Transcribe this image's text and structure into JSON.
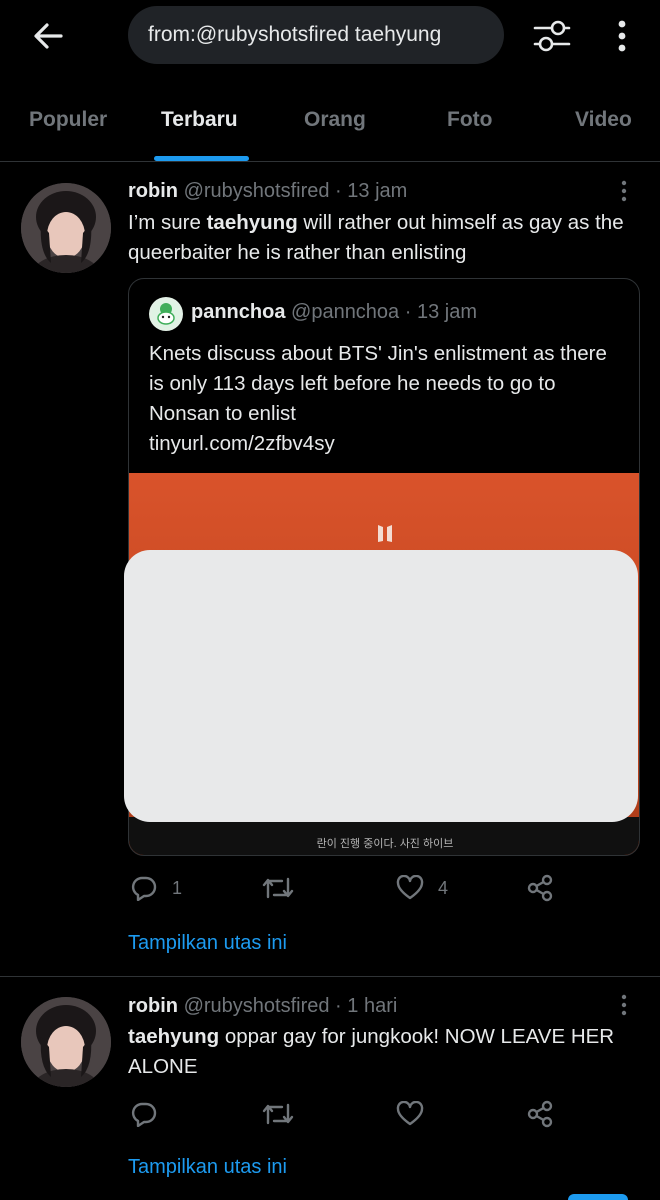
{
  "search": {
    "query": "from:@rubyshotsfired taehyung"
  },
  "tabs": [
    {
      "label": "Populer"
    },
    {
      "label": "Terbaru"
    },
    {
      "label": "Orang"
    },
    {
      "label": "Foto"
    },
    {
      "label": "Video"
    }
  ],
  "active_tab": "Terbaru",
  "tweets": [
    {
      "name": "robin",
      "handle": "@rubyshotsfired",
      "dot": "·",
      "time": "13 jam",
      "text_parts": [
        "I’m sure ",
        "taehyung",
        " will rather out himself as gay as the queerbaiter he is rather than enlisting"
      ],
      "quote": {
        "name": "pannchoa",
        "handle": "@pannchoa",
        "dot": "·",
        "time": "13 jam",
        "text": "Knets discuss about BTS' Jin's enlistment as there is only 113 days left before he needs to go to Nonsan to enlist",
        "link": "tinyurl.com/2zfbv4sy",
        "caption": "란이 진행 중이다. 사진 하이브"
      },
      "replies": "1",
      "retweets": "",
      "likes": "4",
      "show_thread": "Tampilkan utas ini"
    },
    {
      "name": "robin",
      "handle": "@rubyshotsfired",
      "dot": "·",
      "time": "1 hari",
      "text_parts": [
        "taehyung",
        " oppar gay for jungkook! NOW LEAVE HER ALONE"
      ],
      "replies": "",
      "retweets": "",
      "likes": "",
      "show_thread": "Tampilkan utas ini"
    }
  ],
  "icons": {
    "back": "arrow-left-icon",
    "filter": "sliders-icon",
    "more": "more-vertical-icon",
    "reply": "reply-icon",
    "retweet": "retweet-icon",
    "like": "heart-icon",
    "share": "share-icon"
  },
  "colors": {
    "accent": "#1d9bf0",
    "background": "#000000",
    "muted": "#71767b",
    "media_orange": "#d9532b"
  }
}
